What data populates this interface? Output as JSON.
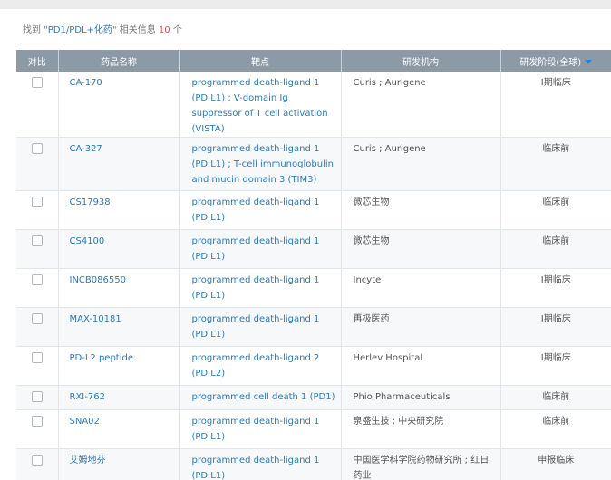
{
  "summary": {
    "prefix": "找到 \"",
    "query": "PD1/PDL+化药",
    "mid": "\" 相关信息 ",
    "count": "10",
    "suffix": " 个"
  },
  "table": {
    "headers": {
      "compare": "对比",
      "drug_name": "药品名称",
      "target": "靶点",
      "org": "研发机构",
      "stage": "研发阶段(全球)"
    },
    "rows": [
      {
        "name": "CA-170",
        "target": "programmed death-ligand 1 (PD L1) ; V-domain Ig suppressor of T cell activation (VISTA)",
        "org": "Curis ; Aurigene",
        "stage": "I期临床"
      },
      {
        "name": "CA-327",
        "target": "programmed death-ligand 1 (PD L1) ; T-cell immunoglobulin and mucin domain 3 (TIM3)",
        "org": "Curis ; Aurigene",
        "stage": "临床前"
      },
      {
        "name": "CS17938",
        "target": "programmed death-ligand 1 (PD L1)",
        "org": "微芯生物",
        "stage": "临床前"
      },
      {
        "name": "CS4100",
        "target": "programmed death-ligand 1 (PD L1)",
        "org": "微芯生物",
        "stage": "临床前"
      },
      {
        "name": "INCB086550",
        "target": "programmed death-ligand 1 (PD L1)",
        "org": "Incyte",
        "stage": "I期临床"
      },
      {
        "name": "MAX-10181",
        "target": "programmed death-ligand 1 (PD L1)",
        "org": "再极医药",
        "stage": "I期临床"
      },
      {
        "name": "PD-L2 peptide",
        "target": "programmed death-ligand 2 (PD L2)",
        "org": "Herlev Hospital",
        "stage": "I期临床"
      },
      {
        "name": "RXI-762",
        "target": "programmed cell death 1 (PD1)",
        "org": "Phio Pharmaceuticals",
        "stage": "临床前"
      },
      {
        "name": "SNA02",
        "target": "programmed death-ligand 1 (PD L1)",
        "org": "泉盛生技 ; 中央研究院",
        "stage": "临床前"
      },
      {
        "name": "艾姆地芬",
        "target": "programmed death-ligand 1 (PD L1)",
        "org": "中国医学科学院药物研究所 ; 红日药业",
        "stage": "申报临床"
      }
    ]
  },
  "colors": {
    "header_bg": "#8c9aa6",
    "link": "#2d7bb4",
    "count": "#d9534f",
    "sort_arrow": "#1e88e5"
  },
  "icons": {
    "sort": "sort-desc-icon",
    "checkbox": "checkbox-icon"
  }
}
